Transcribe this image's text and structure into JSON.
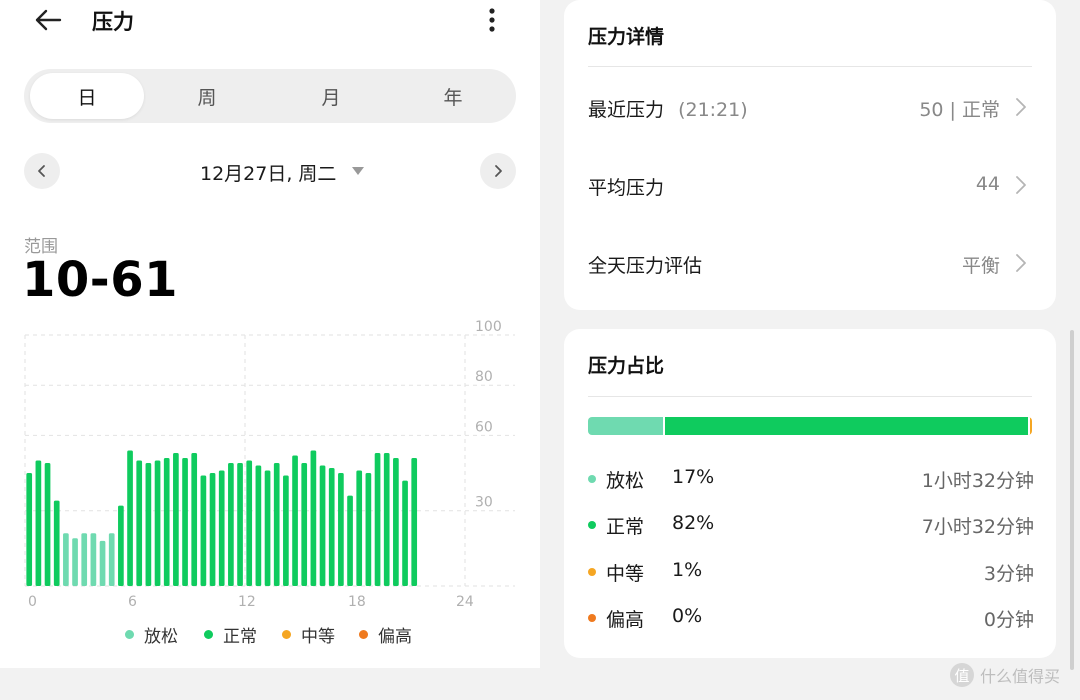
{
  "header": {
    "title": "压力"
  },
  "tabs": [
    {
      "label": "日",
      "active": true
    },
    {
      "label": "周",
      "active": false
    },
    {
      "label": "月",
      "active": false
    },
    {
      "label": "年",
      "active": false
    }
  ],
  "date_nav": {
    "date": "12月27日, 周二"
  },
  "summary": {
    "range_label": "范围",
    "range_value": "10-61"
  },
  "chart_data": {
    "type": "bar",
    "title": "",
    "xlabel": "",
    "ylabel": "",
    "x_ticks": [
      "0",
      "6",
      "12",
      "18",
      "24"
    ],
    "y_ticks": [
      "100",
      "80",
      "60",
      "30"
    ],
    "xlim": [
      0,
      24
    ],
    "ylim": [
      0,
      100
    ],
    "grid": true,
    "interval_hours": 0.5,
    "colors": {
      "relaxed": "#6fdab0",
      "normal": "#0fcb5e",
      "medium": "#f5a623",
      "high": "#ef7a1f"
    },
    "bars": [
      {
        "x": 0,
        "value": 45,
        "level": "normal"
      },
      {
        "x": 0.5,
        "value": 50,
        "level": "normal"
      },
      {
        "x": 1,
        "value": 49,
        "level": "normal"
      },
      {
        "x": 1.5,
        "value": 34,
        "level": "normal"
      },
      {
        "x": 2,
        "value": 21,
        "level": "relaxed"
      },
      {
        "x": 2.5,
        "value": 19,
        "level": "relaxed"
      },
      {
        "x": 3,
        "value": 21,
        "level": "relaxed"
      },
      {
        "x": 3.5,
        "value": 21,
        "level": "relaxed"
      },
      {
        "x": 4,
        "value": 18,
        "level": "relaxed"
      },
      {
        "x": 4.5,
        "value": 21,
        "level": "relaxed"
      },
      {
        "x": 5,
        "value": 32,
        "level": "normal"
      },
      {
        "x": 5.5,
        "value": 54,
        "level": "normal"
      },
      {
        "x": 6,
        "value": 50,
        "level": "normal"
      },
      {
        "x": 6.5,
        "value": 49,
        "level": "normal"
      },
      {
        "x": 7,
        "value": 50,
        "level": "normal"
      },
      {
        "x": 7.5,
        "value": 51,
        "level": "normal"
      },
      {
        "x": 8,
        "value": 53,
        "level": "normal"
      },
      {
        "x": 8.5,
        "value": 51,
        "level": "normal"
      },
      {
        "x": 9,
        "value": 53,
        "level": "normal"
      },
      {
        "x": 9.5,
        "value": 44,
        "level": "normal"
      },
      {
        "x": 10,
        "value": 45,
        "level": "normal"
      },
      {
        "x": 10.5,
        "value": 46,
        "level": "normal"
      },
      {
        "x": 11,
        "value": 49,
        "level": "normal"
      },
      {
        "x": 11.5,
        "value": 49,
        "level": "normal"
      },
      {
        "x": 12,
        "value": 50,
        "level": "normal"
      },
      {
        "x": 12.5,
        "value": 48,
        "level": "normal"
      },
      {
        "x": 13,
        "value": 46,
        "level": "normal"
      },
      {
        "x": 13.5,
        "value": 49,
        "level": "normal"
      },
      {
        "x": 14,
        "value": 44,
        "level": "normal"
      },
      {
        "x": 14.5,
        "value": 52,
        "level": "normal"
      },
      {
        "x": 15,
        "value": 49,
        "level": "normal"
      },
      {
        "x": 15.5,
        "value": 54,
        "level": "normal"
      },
      {
        "x": 16,
        "value": 48,
        "level": "normal"
      },
      {
        "x": 16.5,
        "value": 47,
        "level": "normal"
      },
      {
        "x": 17,
        "value": 45,
        "level": "normal"
      },
      {
        "x": 17.5,
        "value": 36,
        "level": "normal"
      },
      {
        "x": 18,
        "value": 46,
        "level": "normal"
      },
      {
        "x": 18.5,
        "value": 45,
        "level": "normal"
      },
      {
        "x": 19,
        "value": 53,
        "level": "normal"
      },
      {
        "x": 19.5,
        "value": 53,
        "level": "normal"
      },
      {
        "x": 20,
        "value": 51,
        "level": "normal"
      },
      {
        "x": 20.5,
        "value": 42,
        "level": "normal"
      },
      {
        "x": 21,
        "value": 51,
        "level": "normal"
      }
    ]
  },
  "legend": [
    {
      "label": "放松",
      "color": "#6fdab0"
    },
    {
      "label": "正常",
      "color": "#0fcb5e"
    },
    {
      "label": "中等",
      "color": "#f5a623"
    },
    {
      "label": "偏高",
      "color": "#ef7a1f"
    }
  ],
  "details": {
    "title": "压力详情",
    "rows": [
      {
        "label": "最近压力",
        "sub": "(21:21)",
        "value": "50 | 正常"
      },
      {
        "label": "平均压力",
        "sub": "",
        "value": "44"
      },
      {
        "label": "全天压力评估",
        "sub": "",
        "value": "平衡"
      }
    ]
  },
  "ratio": {
    "title": "压力占比",
    "items": [
      {
        "label": "放松",
        "percent": "17%",
        "duration": "1小时32分钟",
        "color": "#6fdab0",
        "share": 0.17
      },
      {
        "label": "正常",
        "percent": "82%",
        "duration": "7小时32分钟",
        "color": "#0fcb5e",
        "share": 0.82
      },
      {
        "label": "中等",
        "percent": "1%",
        "duration": "3分钟",
        "color": "#f5a623",
        "share": 0.01
      },
      {
        "label": "偏高",
        "percent": "0%",
        "duration": "0分钟",
        "color": "#ef7a1f",
        "share": 0
      }
    ]
  },
  "watermark": {
    "logo": "值",
    "text": "什么值得买"
  }
}
